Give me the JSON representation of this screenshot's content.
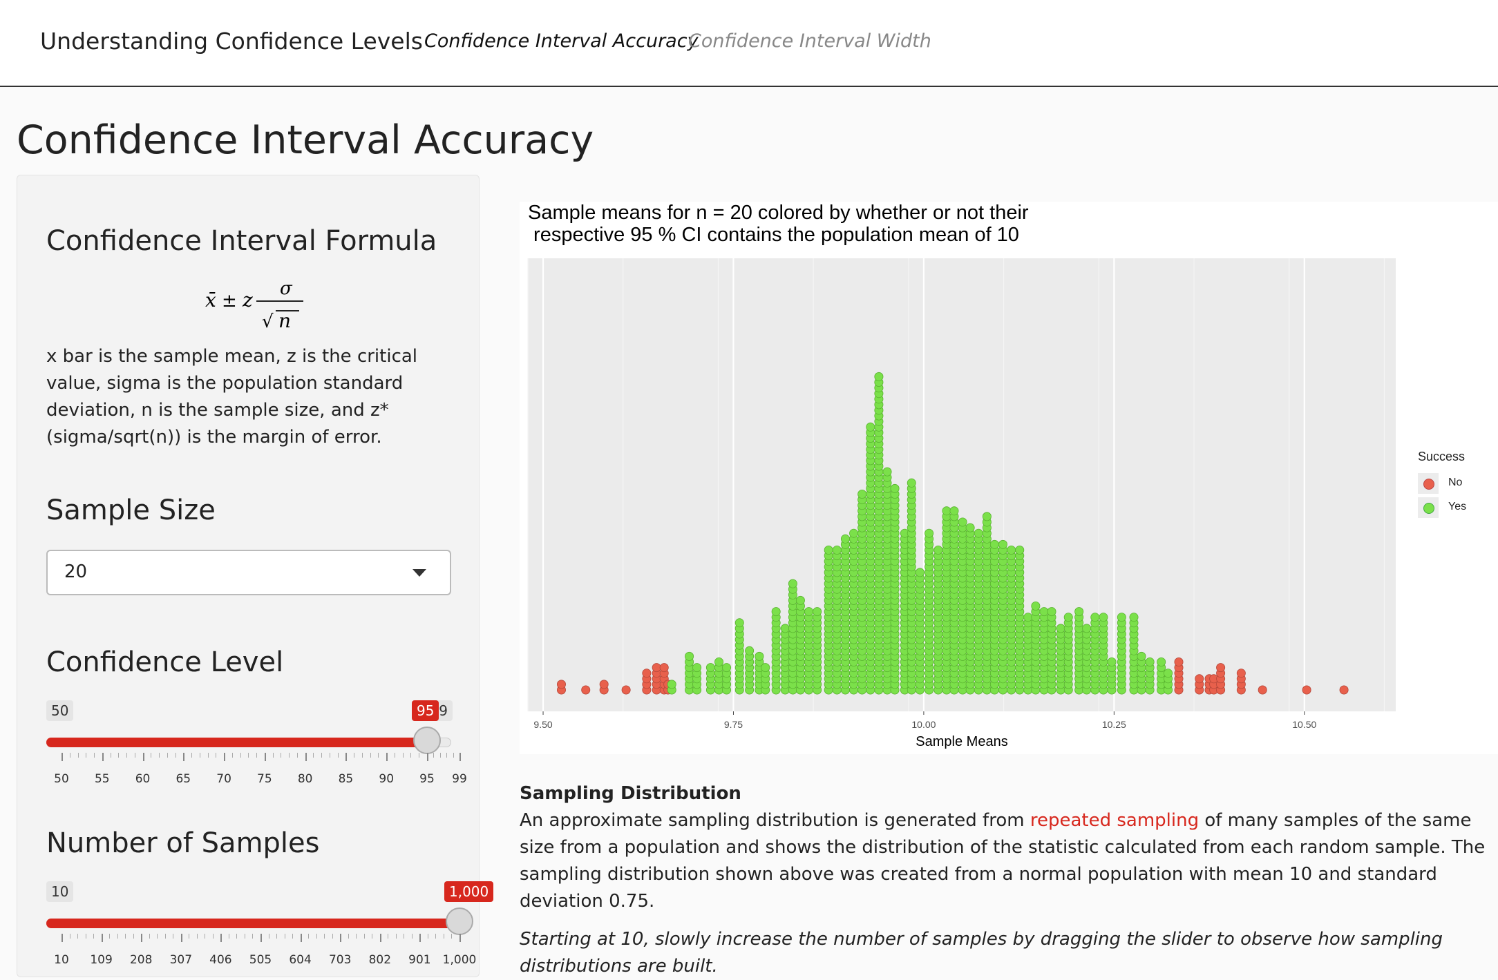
{
  "nav": {
    "brand": "Understanding Confidence Levels",
    "tabs": [
      {
        "label": "Confidence Interval Accuracy",
        "active": true
      },
      {
        "label": "Confidence Interval Width",
        "active": false
      }
    ]
  },
  "page_title": "Confidence Interval Accuracy",
  "sidebar": {
    "formula_heading": "Confidence Interval Formula",
    "formula": {
      "xbar": "x̄",
      "pm": "±",
      "z": "z",
      "sigma": "σ",
      "sqrt": "√",
      "n": "n"
    },
    "description": "x bar is the sample mean, z is the critical value, sigma is the population standard deviation, n is the sample size, and z*(sigma/sqrt(n)) is the margin of error.",
    "sample_size": {
      "heading": "Sample Size",
      "value": "20"
    },
    "confidence_level": {
      "heading": "Confidence Level",
      "min_label": "50",
      "max_label": "99",
      "current_label": "95",
      "min": 50,
      "max": 99,
      "value": 95,
      "ticks": [
        "50",
        "55",
        "60",
        "65",
        "70",
        "75",
        "80",
        "85",
        "90",
        "95",
        "99"
      ],
      "tick_values": [
        50,
        55,
        60,
        65,
        70,
        75,
        80,
        85,
        90,
        95,
        99
      ]
    },
    "num_samples": {
      "heading": "Number of Samples",
      "min_label": "10",
      "max_label": "1,000",
      "current_label": "1,000",
      "min": 10,
      "max": 1000,
      "value": 1000,
      "ticks": [
        "10",
        "109",
        "208",
        "307",
        "406",
        "505",
        "604",
        "703",
        "802",
        "901",
        "1,000"
      ],
      "tick_values": [
        10,
        109,
        208,
        307,
        406,
        505,
        604,
        703,
        802,
        901,
        1000
      ]
    }
  },
  "legend": {
    "title": "Success",
    "items": [
      {
        "label": "No",
        "color": "#e8604c"
      },
      {
        "label": "Yes",
        "color": "#7be04a"
      }
    ]
  },
  "chart_data": {
    "type": "scatter",
    "subtype": "dotplot",
    "title_line1": "Sample means for n = 20 colored by whether or not their",
    "title_line2": " respective 95 % CI contains the population mean of 10",
    "xlabel": "Sample Means",
    "ylabel": "",
    "xlim": [
      9.48,
      10.62
    ],
    "x_ticks": [
      "9.50",
      "9.75",
      "10.00",
      "10.25",
      "10.50"
    ],
    "x_tick_values": [
      9.5,
      9.75,
      10.0,
      10.25,
      10.5
    ],
    "grid": true,
    "legend_position": "right",
    "series": [
      {
        "name": "No",
        "color": "#e8604c",
        "x": [
          9.524,
          9.556,
          9.58,
          9.609,
          9.636,
          9.649,
          9.659,
          9.664,
          10.335,
          10.362,
          10.375,
          10.381,
          10.39,
          10.417,
          10.445,
          10.503,
          10.552
        ],
        "counts": [
          2,
          1,
          2,
          1,
          4,
          5,
          5,
          2,
          6,
          3,
          3,
          3,
          5,
          4,
          1,
          1,
          1
        ]
      },
      {
        "name": "Yes",
        "color": "#7be04a",
        "x": [
          9.669,
          9.692,
          9.702,
          9.72,
          9.731,
          9.741,
          9.758,
          9.771,
          9.784,
          9.792,
          9.806,
          9.818,
          9.828,
          9.838,
          9.849,
          9.86,
          9.875,
          9.886,
          9.897,
          9.908,
          9.919,
          9.93,
          9.941,
          9.952,
          9.962,
          9.975,
          9.984,
          9.995,
          10.007,
          10.019,
          10.03,
          10.04,
          10.051,
          10.061,
          10.072,
          10.083,
          10.093,
          10.104,
          10.115,
          10.126,
          10.137,
          10.147,
          10.158,
          10.168,
          10.18,
          10.19,
          10.204,
          10.214,
          10.225,
          10.236,
          10.247,
          10.26,
          10.276,
          10.286,
          10.297,
          10.312,
          10.321
        ],
        "counts": [
          2,
          7,
          5,
          5,
          6,
          5,
          13,
          8,
          7,
          5,
          15,
          12,
          20,
          17,
          15,
          15,
          26,
          26,
          28,
          29,
          36,
          48,
          57,
          40,
          37,
          29,
          38,
          22,
          29,
          26,
          33,
          33,
          31,
          30,
          29,
          32,
          27,
          27,
          26,
          26,
          14,
          16,
          15,
          15,
          12,
          14,
          15,
          12,
          14,
          14,
          6,
          14,
          14,
          7,
          6,
          6,
          4
        ]
      }
    ]
  },
  "main_text": {
    "heading": "Sampling Distribution",
    "para_pre": "An approximate sampling distribution is generated from ",
    "para_link": "repeated sampling",
    "para_post": " of many samples of the same size from a population and shows the distribution of the statistic calculated from each random sample. The sampling distribution shown above was created from a normal population with mean 10 and standard deviation 0.75.",
    "note": "Starting at 10, slowly increase the number of samples by dragging the slider to observe how sampling distributions are built."
  }
}
